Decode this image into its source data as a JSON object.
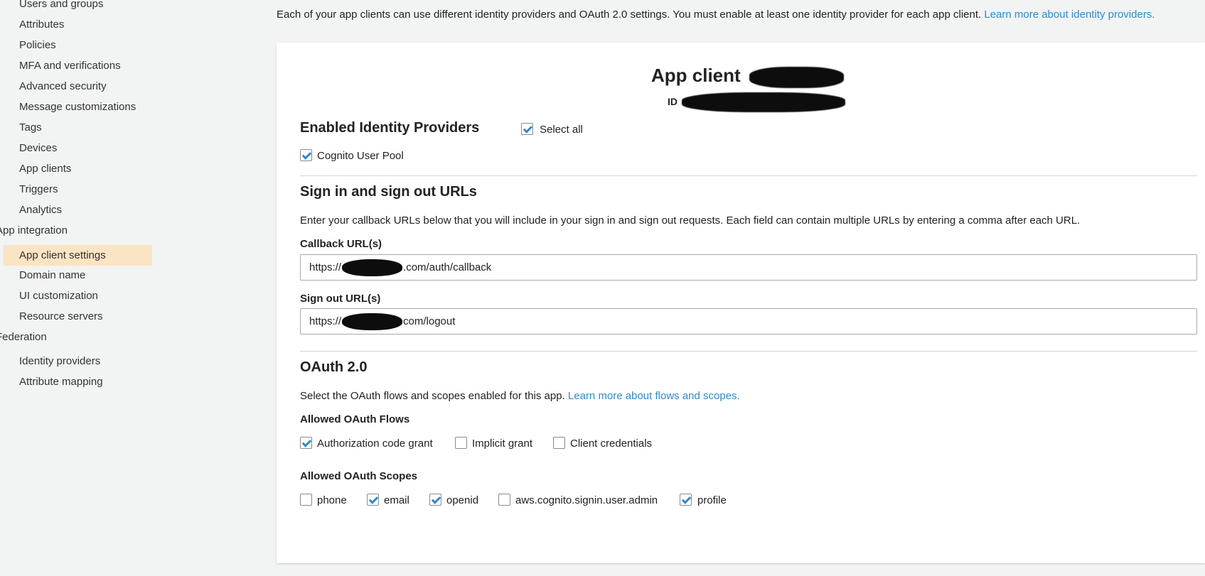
{
  "sidebar": {
    "items": [
      {
        "label": "Users and groups"
      },
      {
        "label": "Attributes"
      },
      {
        "label": "Policies"
      },
      {
        "label": "MFA and verifications"
      },
      {
        "label": "Advanced security"
      },
      {
        "label": "Message customizations"
      },
      {
        "label": "Tags"
      },
      {
        "label": "Devices"
      },
      {
        "label": "App clients"
      },
      {
        "label": "Triggers"
      },
      {
        "label": "Analytics"
      }
    ],
    "section_app_integration": "App integration",
    "app_integration_items": [
      {
        "label": "App client settings"
      },
      {
        "label": "Domain name"
      },
      {
        "label": "UI customization"
      },
      {
        "label": "Resource servers"
      }
    ],
    "section_federation": "Federation",
    "federation_items": [
      {
        "label": "Identity providers"
      },
      {
        "label": "Attribute mapping"
      }
    ],
    "active_item": "App client settings",
    "active_color": "#fbe4c4"
  },
  "intro": {
    "text": "Each of your app clients can use different identity providers and OAuth 2.0 settings. You must enable at least one identity provider for each app client.",
    "link": "Learn more about identity providers."
  },
  "client": {
    "title": "App client",
    "id_label": "ID"
  },
  "identity_providers": {
    "heading": "Enabled Identity Providers",
    "select_all_label": "Select all",
    "select_all_checked": true,
    "providers": [
      {
        "label": "Cognito User Pool",
        "checked": true
      }
    ]
  },
  "urls": {
    "heading": "Sign in and sign out URLs",
    "description": "Enter your callback URLs below that you will include in your sign in and sign out requests. Each field can contain multiple URLs by entering a comma after each URL.",
    "callback_label": "Callback URL(s)",
    "callback_prefix": "https://",
    "callback_suffix": ".com/auth/callback",
    "signout_label": "Sign out URL(s)",
    "signout_prefix": "https://",
    "signout_suffix": "com/logout"
  },
  "oauth": {
    "heading": "OAuth 2.0",
    "description": "Select the OAuth flows and scopes enabled for this app.",
    "link": "Learn more about flows and scopes.",
    "flows_label": "Allowed OAuth Flows",
    "flows": [
      {
        "label": "Authorization code grant",
        "checked": true
      },
      {
        "label": "Implicit grant",
        "checked": false
      },
      {
        "label": "Client credentials",
        "checked": false
      }
    ],
    "scopes_label": "Allowed OAuth Scopes",
    "scopes": [
      {
        "label": "phone",
        "checked": false
      },
      {
        "label": "email",
        "checked": true
      },
      {
        "label": "openid",
        "checked": true
      },
      {
        "label": "aws.cognito.signin.user.admin",
        "checked": false
      },
      {
        "label": "profile",
        "checked": true
      }
    ]
  },
  "colors": {
    "link": "#2e8bc9",
    "checkbox_check": "#2e8bc9",
    "page_background": "#f2f3f3"
  }
}
